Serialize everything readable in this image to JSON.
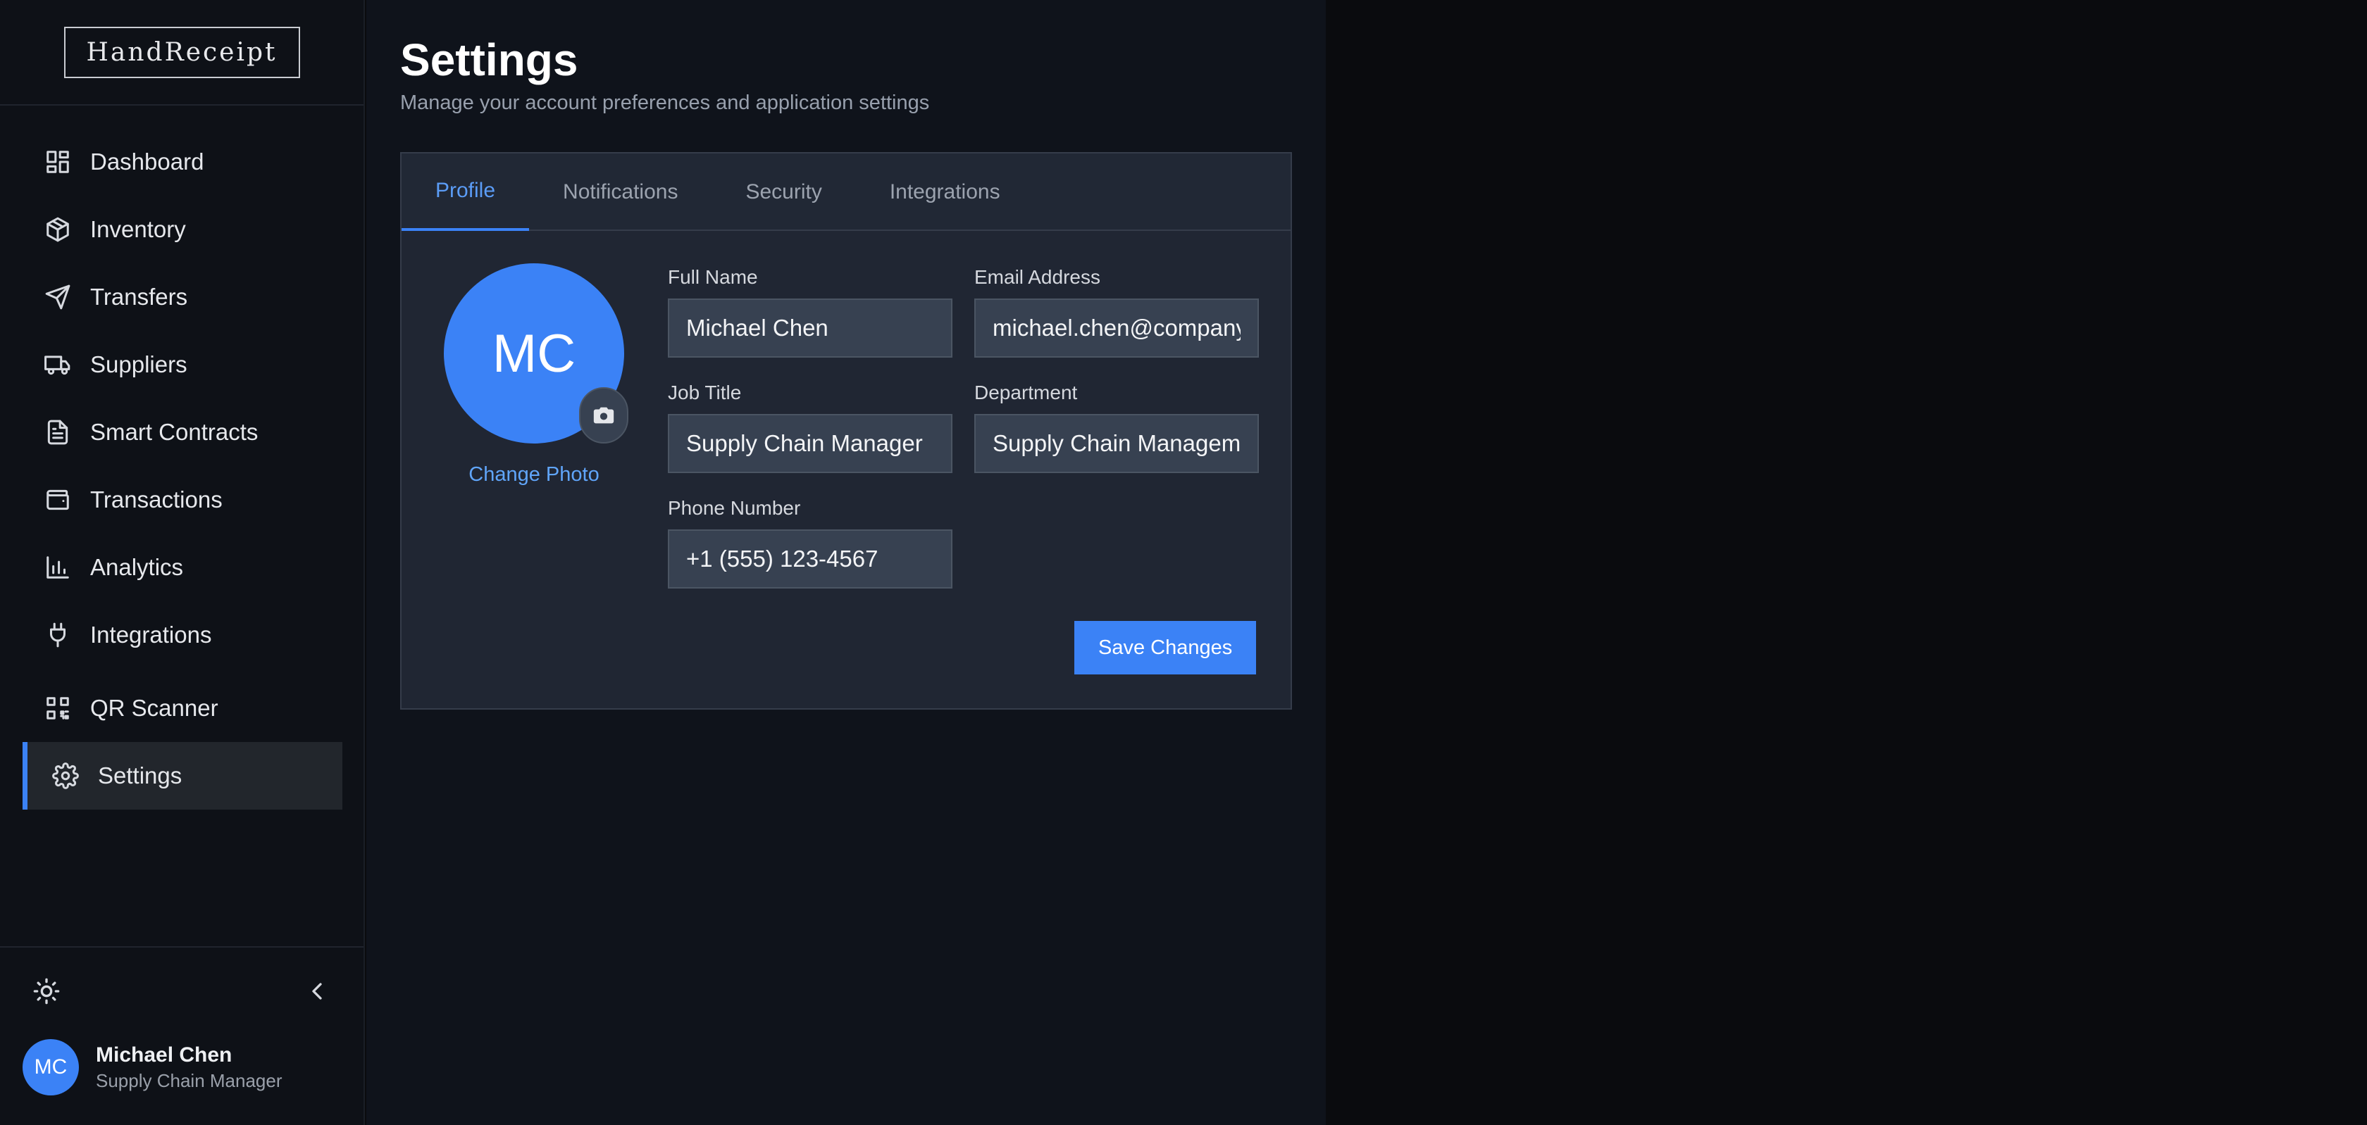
{
  "sidebar": {
    "logo": "HandReceipt",
    "items": [
      {
        "label": "Dashboard",
        "icon": "dashboard-icon"
      },
      {
        "label": "Inventory",
        "icon": "package-icon"
      },
      {
        "label": "Transfers",
        "icon": "send-icon"
      },
      {
        "label": "Suppliers",
        "icon": "truck-icon"
      },
      {
        "label": "Smart Contracts",
        "icon": "document-icon"
      },
      {
        "label": "Transactions",
        "icon": "wallet-icon"
      },
      {
        "label": "Analytics",
        "icon": "bar-chart-icon"
      },
      {
        "label": "Integrations",
        "icon": "plug-icon"
      },
      {
        "label": "QR Scanner",
        "icon": "qr-code-icon"
      },
      {
        "label": "Settings",
        "icon": "gear-icon",
        "active": true
      }
    ],
    "user": {
      "initials": "MC",
      "name": "Michael Chen",
      "role": "Supply Chain Manager"
    }
  },
  "main": {
    "title": "Settings",
    "subtitle": "Manage your account preferences and application settings",
    "tabs": [
      {
        "label": "Profile",
        "active": true
      },
      {
        "label": "Notifications"
      },
      {
        "label": "Security"
      },
      {
        "label": "Integrations"
      }
    ],
    "profile": {
      "avatar_initials": "MC",
      "change_photo": "Change Photo",
      "fields": {
        "full_name": {
          "label": "Full Name",
          "value": "Michael Chen"
        },
        "email": {
          "label": "Email Address",
          "value": "michael.chen@company.com"
        },
        "job_title": {
          "label": "Job Title",
          "value": "Supply Chain Manager"
        },
        "department": {
          "label": "Department",
          "value": "Supply Chain Management"
        },
        "phone": {
          "label": "Phone Number",
          "value": "+1 (555) 123-4567"
        }
      },
      "save_label": "Save Changes"
    }
  },
  "colors": {
    "accent": "#3b82f6",
    "sidebar_bg": "#0e1117",
    "main_bg": "#0f131b",
    "card_bg": "#202633"
  }
}
